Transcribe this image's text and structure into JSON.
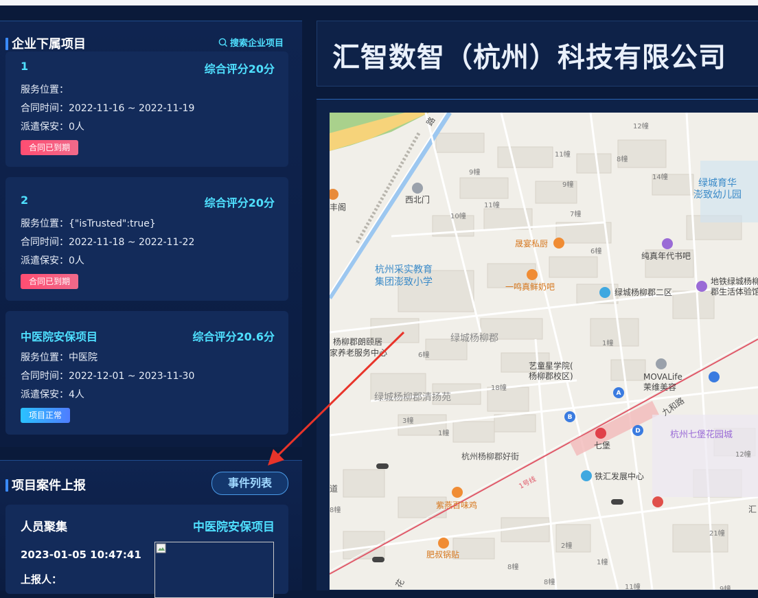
{
  "projects": {
    "title": "企业下属项目",
    "search_label": "搜索企业项目",
    "items": [
      {
        "name": "1",
        "score": "综合评分20分",
        "location": "服务位置：",
        "contract": "合同时间：2022-11-16 ~ 2022-11-19",
        "guards": "派遣保安：0人",
        "status": "合同已到期"
      },
      {
        "name": "2",
        "score": "综合评分20分",
        "location": "服务位置：{\"isTrusted\":true}",
        "contract": "合同时间：2022-11-18 ~ 2022-11-22",
        "guards": "派遣保安：0人",
        "status": "合同已到期"
      },
      {
        "name": "中医院安保项目",
        "score": "综合评分20.6分",
        "location": "服务位置：中医院",
        "contract": "合同时间：2022-12-01 ~ 2023-11-30",
        "guards": "派遣保安：4人",
        "status": "项目正常"
      }
    ]
  },
  "cases": {
    "title": "项目案件上报",
    "list_button": "事件列表",
    "item": {
      "type": "人员聚集",
      "project": "中医院安保项目",
      "time": "2023-01-05 10:47:41",
      "reporter": "上报人："
    }
  },
  "company": {
    "name": "汇智数智（杭州）科技有限公司"
  },
  "map": {
    "labels": {
      "l1": "12幢",
      "l2": "8幢",
      "l3": "11幢",
      "l4": "9幢",
      "l5": "14幢",
      "l6": "9幢",
      "l7": "11幢",
      "l8": "10幢",
      "l9": "7幢",
      "l10": "西北门",
      "l11": "丰阁",
      "l12": "绿城育华",
      "l13": "澎致幼儿园",
      "l14": "晟宴私厨",
      "l15": "6幢",
      "l16": "纯真年代书吧",
      "l17": "杭州采实教育",
      "l18": "集团澎致小学",
      "l19": "一鸣真鲜奶吧",
      "l20": "绿城杨柳郡二区",
      "l21": "地铁绿城杨柳",
      "l22": "郡生活体验馆",
      "l23": "杨柳郡朗颐居",
      "l24": "家养老服务中心",
      "l25": "绿城杨柳郡",
      "l26": "1幢",
      "l27": "6幢",
      "l28": "艺童星学院(",
      "l29": "杨柳郡校区)",
      "l30": "MOVALife",
      "l31": "茉维美容",
      "l32": "绿城杨柳郡清扬苑",
      "l33": "18幢",
      "l34": "九和路",
      "l35": "3幢",
      "l36": "1幢",
      "l37": "七堡",
      "l38": "杭州七堡花园城",
      "l39": "杭州杨柳郡好街",
      "l40": "12幢",
      "l41": "铁汇发展中心",
      "l42": "紫燕百味鸡",
      "l43": "1号线",
      "l44": "道",
      "l45": "8幢",
      "l46": "21幢",
      "l47": "肥叔锅贴",
      "l48": "2幢",
      "l49": "8幢",
      "l50": "1幢",
      "l51": "汇",
      "l52": "路",
      "l53": "8幢",
      "l54": "11幢",
      "l55": "9幢",
      "l56": "A",
      "l57": "B",
      "l58": "D",
      "l59": "花"
    }
  },
  "colors": {
    "accent": "#4fe0ff",
    "expired": "#ff4d72",
    "normal": "#2ac2ff",
    "panel": "#132b5a",
    "arrow": "#e8342a"
  }
}
